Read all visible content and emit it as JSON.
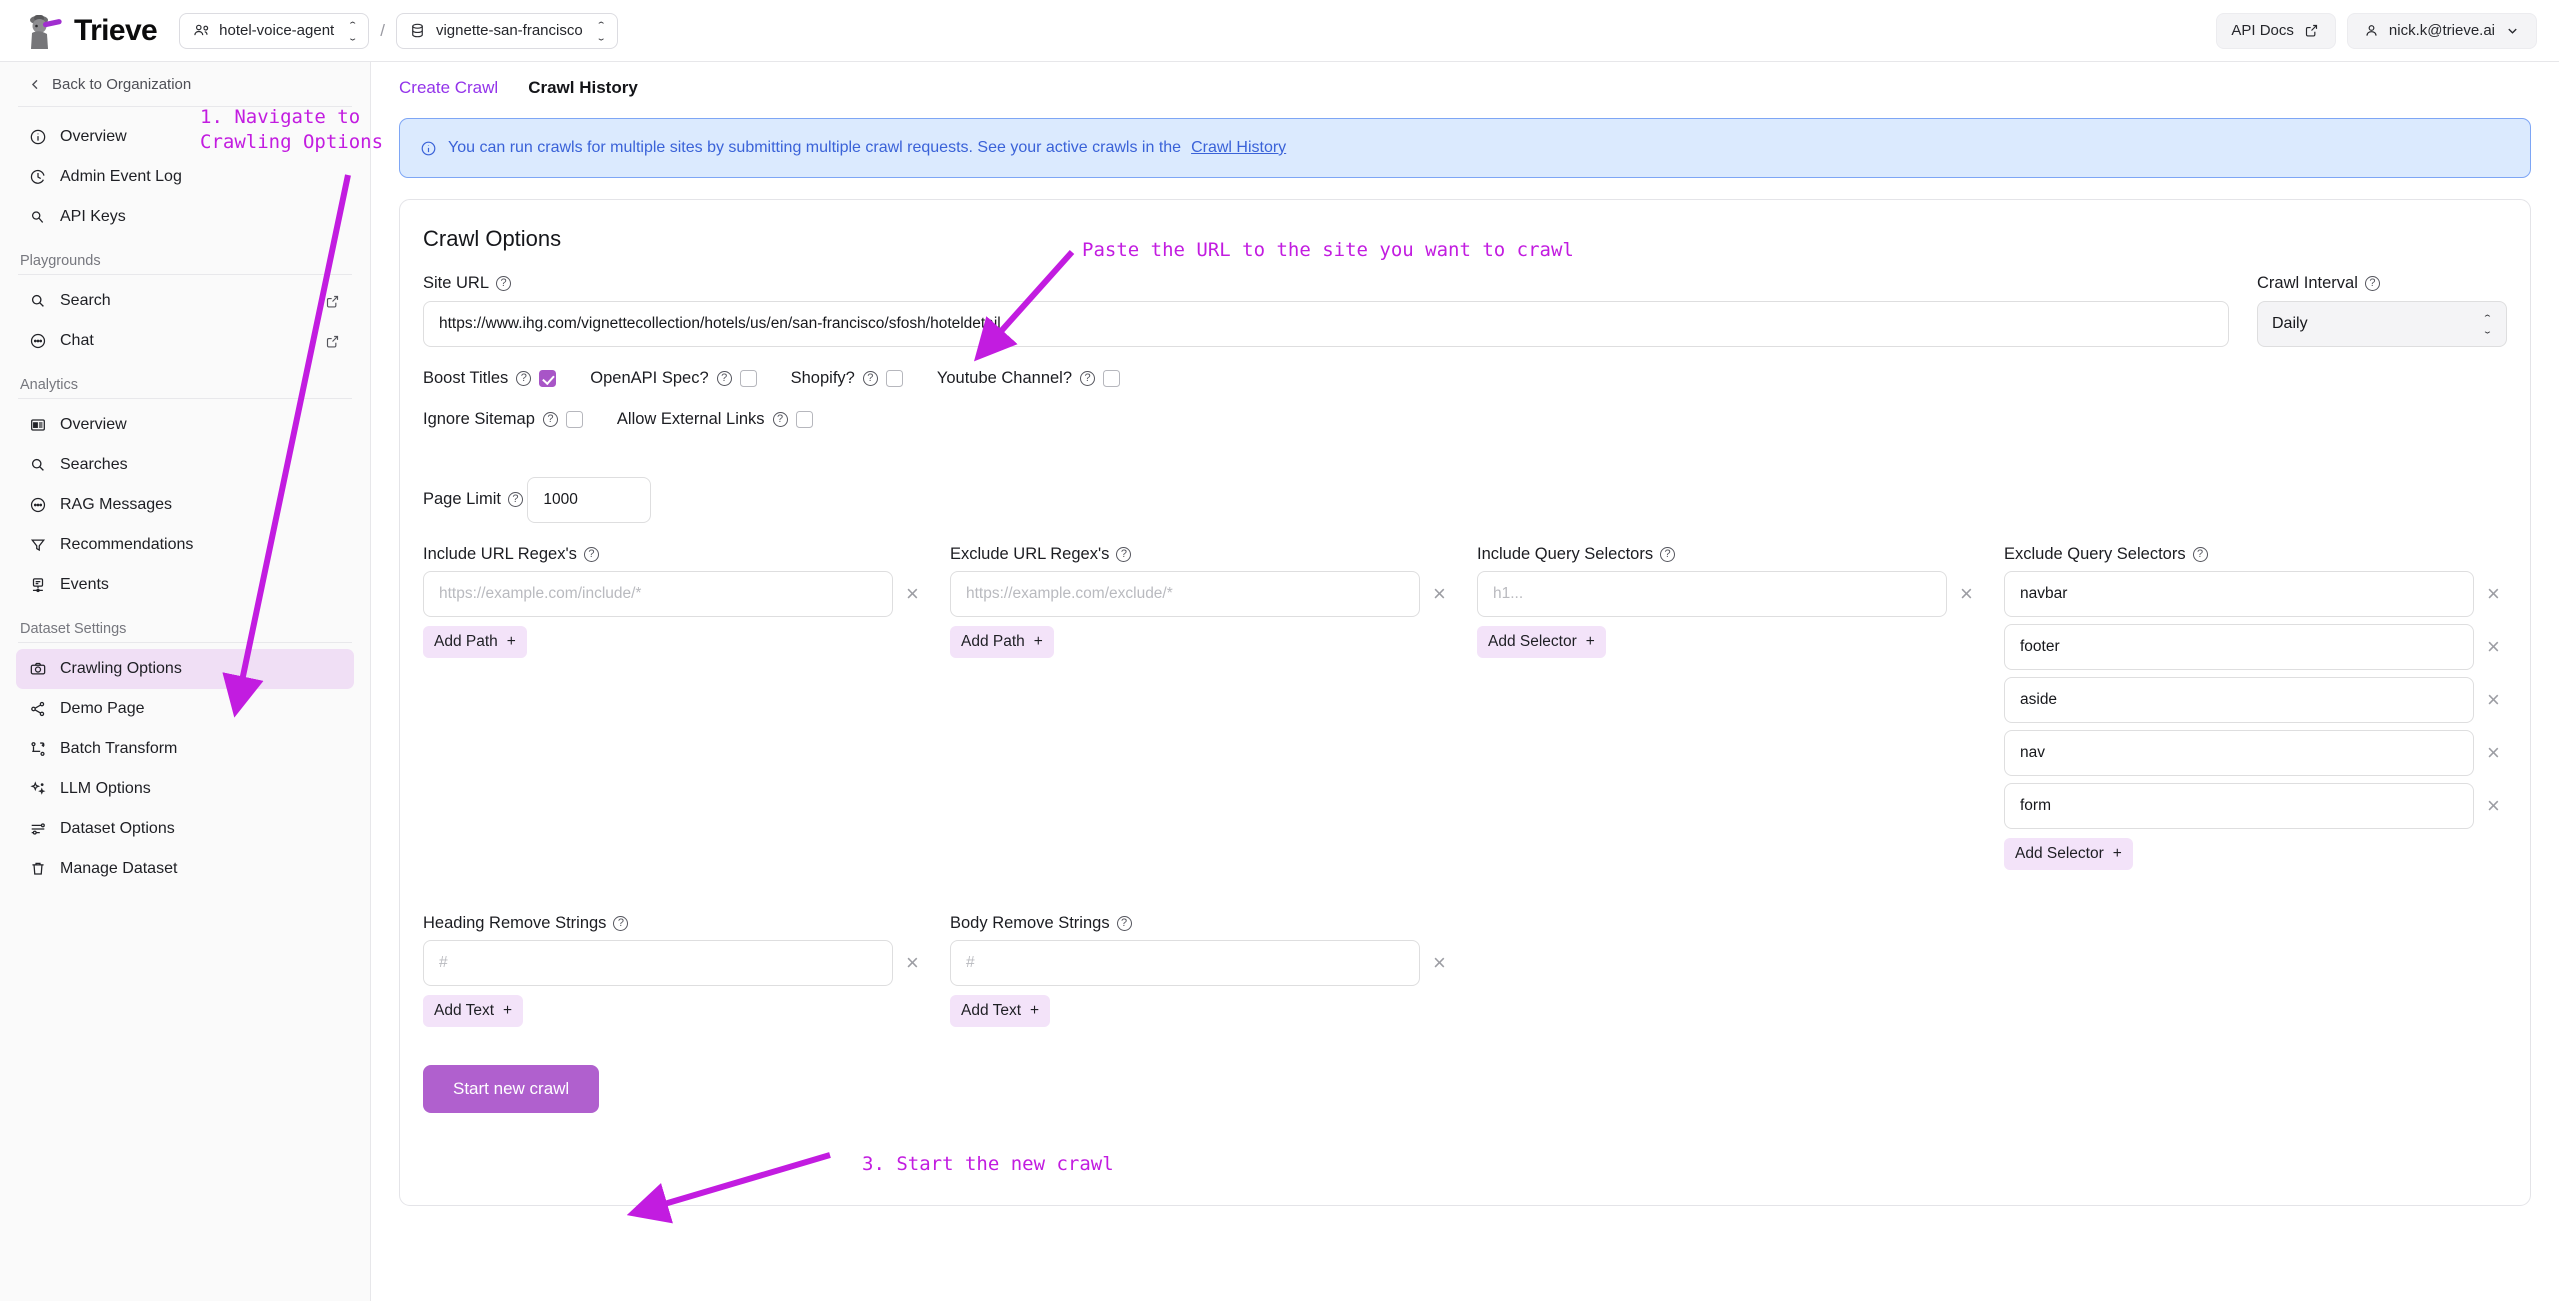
{
  "header": {
    "brand": "Trieve",
    "logo_icon": "detective-spyglass-logo",
    "org_selector": {
      "label": "hotel-voice-agent",
      "icon": "users-icon"
    },
    "separator": "/",
    "dataset_selector": {
      "label": "vignette-san-francisco",
      "icon": "database-icon"
    },
    "api_docs": {
      "label": "API Docs",
      "icon": "external-link-icon"
    },
    "account": {
      "label": "nick.k@trieve.ai",
      "icon": "user-icon"
    }
  },
  "sidebar": {
    "back_label": "Back to Organization",
    "top_items": [
      {
        "label": "Overview",
        "icon": "info-circle-icon"
      },
      {
        "label": "Admin Event Log",
        "icon": "clock-history-icon"
      },
      {
        "label": "API Keys",
        "icon": "key-search-icon"
      }
    ],
    "groups": [
      {
        "title": "Playgrounds",
        "items": [
          {
            "label": "Search",
            "icon": "search-icon",
            "external": true
          },
          {
            "label": "Chat",
            "icon": "chat-bubble-icon",
            "external": true
          }
        ]
      },
      {
        "title": "Analytics",
        "items": [
          {
            "label": "Overview",
            "icon": "dashboard-icon",
            "external": false
          },
          {
            "label": "Searches",
            "icon": "search-icon",
            "external": false
          },
          {
            "label": "RAG Messages",
            "icon": "chat-bubble-icon",
            "external": false
          },
          {
            "label": "Recommendations",
            "icon": "filter-icon",
            "external": false
          },
          {
            "label": "Events",
            "icon": "event-node-icon",
            "external": false
          }
        ]
      },
      {
        "title": "Dataset Settings",
        "items": [
          {
            "label": "Crawling Options",
            "icon": "camera-icon",
            "external": false,
            "active": true
          },
          {
            "label": "Demo Page",
            "icon": "share-nodes-icon",
            "external": false
          },
          {
            "label": "Batch Transform",
            "icon": "batch-transform-icon",
            "external": false
          },
          {
            "label": "LLM Options",
            "icon": "sparkles-icon",
            "external": false
          },
          {
            "label": "Dataset Options",
            "icon": "sliders-icon",
            "external": false
          },
          {
            "label": "Manage Dataset",
            "icon": "trash-icon",
            "external": false
          }
        ]
      }
    ]
  },
  "tabs": [
    {
      "label": "Create Crawl",
      "active": false
    },
    {
      "label": "Crawl History",
      "active": true
    }
  ],
  "banner": {
    "icon": "info-circle-icon",
    "text": "You can run crawls for multiple sites by submitting multiple crawl requests. See your active crawls in the ",
    "link": "Crawl History"
  },
  "crawl_options": {
    "title": "Crawl Options",
    "site_url": {
      "label": "Site URL",
      "value": "https://www.ihg.com/vignettecollection/hotels/us/en/san-francisco/sfosh/hoteldetail"
    },
    "crawl_interval": {
      "label": "Crawl Interval",
      "value": "Daily"
    },
    "checkboxes_row1": [
      {
        "label": "Boost Titles",
        "checked": true
      },
      {
        "label": "OpenAPI Spec?",
        "checked": false
      },
      {
        "label": "Shopify?",
        "checked": false
      },
      {
        "label": "Youtube Channel?",
        "checked": false
      }
    ],
    "checkboxes_row2": [
      {
        "label": "Ignore Sitemap",
        "checked": false
      },
      {
        "label": "Allow External Links",
        "checked": false
      }
    ],
    "page_limit": {
      "label": "Page Limit",
      "value": "1000"
    },
    "columns": [
      {
        "label": "Include URL Regex's",
        "add_label": "Add Path",
        "rows": [
          {
            "value": "",
            "placeholder": "https://example.com/include/*"
          }
        ]
      },
      {
        "label": "Exclude URL Regex's",
        "add_label": "Add Path",
        "rows": [
          {
            "value": "",
            "placeholder": "https://example.com/exclude/*"
          }
        ]
      },
      {
        "label": "Include Query Selectors",
        "add_label": "Add Selector",
        "rows": [
          {
            "value": "",
            "placeholder": "h1..."
          }
        ]
      },
      {
        "label": "Exclude Query Selectors",
        "add_label": "Add Selector",
        "rows": [
          {
            "value": "navbar",
            "placeholder": ""
          },
          {
            "value": "footer",
            "placeholder": ""
          },
          {
            "value": "aside",
            "placeholder": ""
          },
          {
            "value": "nav",
            "placeholder": ""
          },
          {
            "value": "form",
            "placeholder": ""
          }
        ]
      }
    ],
    "bottom_columns": [
      {
        "label": "Heading Remove Strings",
        "add_label": "Add Text",
        "rows": [
          {
            "value": "",
            "placeholder": "#"
          }
        ]
      },
      {
        "label": "Body Remove Strings",
        "add_label": "Add Text",
        "rows": [
          {
            "value": "",
            "placeholder": "#"
          }
        ]
      }
    ],
    "submit_label": "Start new crawl",
    "remove_symbol": "×",
    "add_symbol": "+"
  },
  "annotations": {
    "color": "#c21ce0",
    "step1": "1. Navigate to\nCrawling Options",
    "step2": "Paste the URL to the site you want to crawl",
    "step3": "3. Start the new crawl"
  }
}
